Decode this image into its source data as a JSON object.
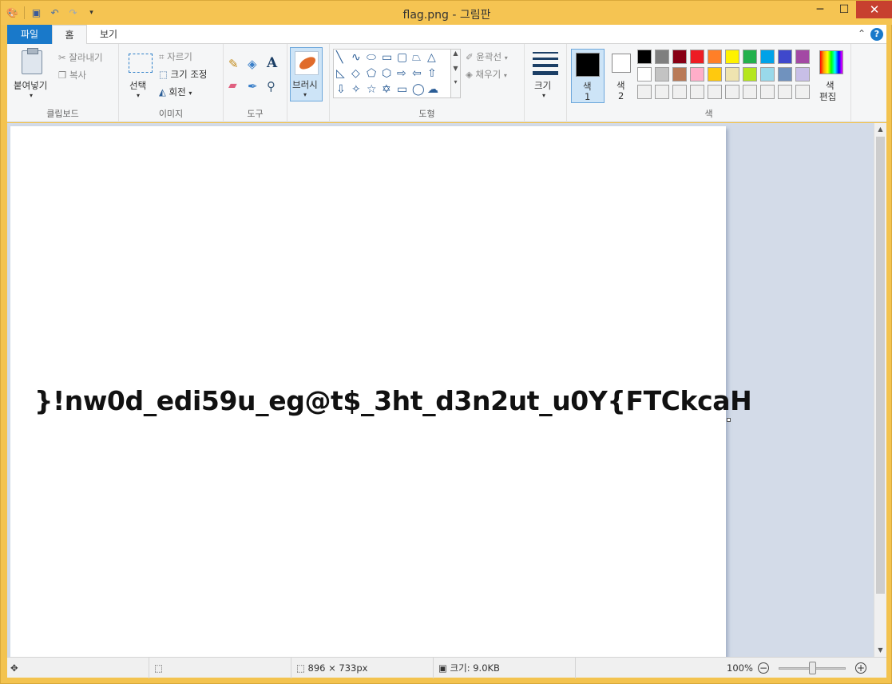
{
  "window": {
    "title": "flag.png - 그림판"
  },
  "tabs": {
    "file": "파일",
    "home": "홈",
    "view": "보기"
  },
  "ribbon": {
    "clipboard": {
      "paste": "붙여넣기",
      "cut": "잘라내기",
      "copy": "복사",
      "label": "클립보드"
    },
    "image": {
      "select": "선택",
      "crop": "자르기",
      "resize": "크기 조정",
      "rotate": "회전",
      "label": "이미지"
    },
    "tools": {
      "label": "도구"
    },
    "brushes": {
      "label": "브러시"
    },
    "shapes": {
      "outline": "윤곽선",
      "fill": "채우기",
      "label": "도형"
    },
    "size": {
      "label": "크기"
    },
    "colors": {
      "color1": "색",
      "color1_num": "1",
      "color2": "색",
      "color2_num": "2",
      "edit": "색",
      "edit2": "편집",
      "label": "색",
      "palette": [
        "#000000",
        "#7f7f7f",
        "#880015",
        "#ed1c24",
        "#ff7f27",
        "#fff200",
        "#22b14c",
        "#00a2e8",
        "#3f48cc",
        "#a349a4",
        "#ffffff",
        "#c3c3c3",
        "#b97a57",
        "#ffaec9",
        "#ffc90e",
        "#efe4b0",
        "#b5e61d",
        "#99d9ea",
        "#7092be",
        "#c8bfe7",
        "#f0f0f0",
        "#f0f0f0",
        "#f0f0f0",
        "#f0f0f0",
        "#f0f0f0",
        "#f0f0f0",
        "#f0f0f0",
        "#f0f0f0",
        "#f0f0f0",
        "#f0f0f0"
      ]
    }
  },
  "canvas": {
    "text": "}!nw0d_edi59u_eg@t$_3ht_d3n2ut_u0Y{FTCkcaH"
  },
  "status": {
    "dimensions": "896 × 733px",
    "filesize": "크기: 9.0KB",
    "zoom": "100%"
  }
}
